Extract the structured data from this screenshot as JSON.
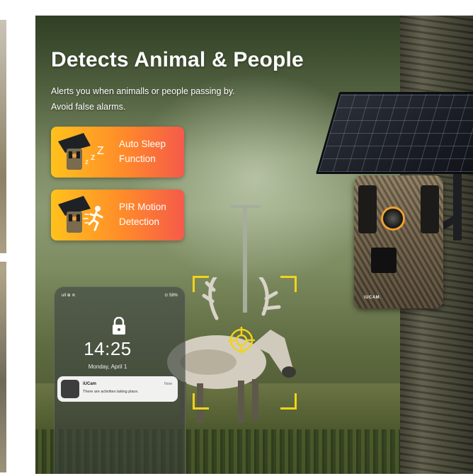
{
  "banner": {
    "headline": "Detects Animal & People",
    "subtext": {
      "line1": "Alerts you when animalls or people passing by.",
      "line2": "Avoid false alarms."
    },
    "features": [
      {
        "line1": "Auto Sleep",
        "line2": "Function",
        "icon": "camera-sleep-icon"
      },
      {
        "line1": "PIR Motion",
        "line2": "Detection",
        "icon": "camera-motion-icon"
      }
    ],
    "colors": {
      "feature_gradient_start": "#ffc21c",
      "feature_gradient_end": "#f55a4a",
      "focus_frame": "#f2d31c",
      "headline": "#ffffff"
    }
  },
  "phone": {
    "status_left": "ull ⊕ ≋",
    "status_right": "⊙ 58%",
    "clock": "14:25",
    "date": "Monday, April 1",
    "notification": {
      "app": "iUCam",
      "time": "Now",
      "message": "There are activities taking place."
    }
  },
  "camera": {
    "brand": "iUCAM"
  }
}
